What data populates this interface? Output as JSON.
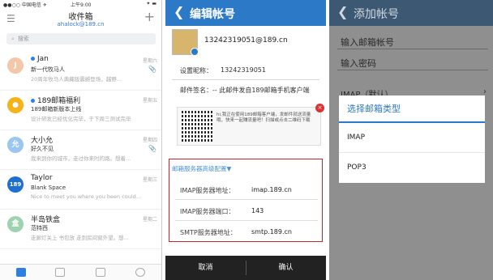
{
  "inbox": {
    "status": {
      "carrier": "●●○○ 中国电信 ✈",
      "time": "上午9:00",
      "battery": "✦ ▬"
    },
    "title": "收件箱",
    "account": "ahalock@189.cn",
    "search_placeholder": "搜索",
    "mails": [
      {
        "avatar": "J",
        "avatar_color": "#f3c7a8",
        "sender": "Jan",
        "unread": true,
        "subject": "新一代牧马人",
        "preview": "20周年牧马人典藏版震撼登场，越野...",
        "date": "星期六",
        "attachment": true
      },
      {
        "avatar": "●",
        "avatar_color": "#f5b21a",
        "sender": "189邮箱福利",
        "unread": true,
        "subject": "189邮箱新版本上线",
        "preview": "设计研发已经优化完毕，于下周三测试完毕",
        "date": "星期五",
        "attachment": false
      },
      {
        "avatar": "允",
        "avatar_color": "#9bc6ee",
        "sender": "大小允",
        "unread": false,
        "subject": "好久不见",
        "preview": "我来到你的城市，走过你来时的路。想着...",
        "date": "星期四",
        "attachment": true
      },
      {
        "avatar": "189",
        "avatar_color": "#1f6fd0",
        "sender": "Taylor",
        "unread": false,
        "subject": "Blank Space",
        "preview": "Nice to meet you where you been could...",
        "date": "星期三",
        "attachment": false
      },
      {
        "avatar": "盒",
        "avatar_color": "#9fd3b0",
        "sender": "半岛铁盒",
        "unread": false,
        "subject": "范特西",
        "preview": "走廊灯关上 书包放 走到房间窗外望。想...",
        "date": "星期二",
        "attachment": false
      }
    ]
  },
  "edit": {
    "title": "编辑帐号",
    "email": "13242319051@189.cn",
    "nickname_label": "设置昵称：",
    "nickname_value": "13242319051",
    "signature_label": "邮件签名：",
    "signature_value": "-- 此邮件发自189邮箱手机客户端",
    "ad_text": "hi,我正在使用189邮箱客户端，发邮件就送流量哦，快来一起赚流量吧！扫描或点击二维码下载",
    "advanced_title": "邮箱服务器高级配置▼",
    "servers": [
      {
        "key": "IMAP服务器地址：",
        "value": "imap.189.cn"
      },
      {
        "key": "IMAP服务器端口：",
        "value": "143"
      },
      {
        "key": "SMTP服务器地址：",
        "value": "smtp.189.cn"
      }
    ],
    "cancel": "取消",
    "confirm": "确认"
  },
  "add": {
    "title": "添加帐号",
    "email_label": "输入邮箱帐号",
    "password_label": "输入密码",
    "imap_default": "IMAP（默认）",
    "dialog": {
      "title": "选择邮箱类型",
      "options": [
        "IMAP",
        "POP3"
      ]
    }
  }
}
